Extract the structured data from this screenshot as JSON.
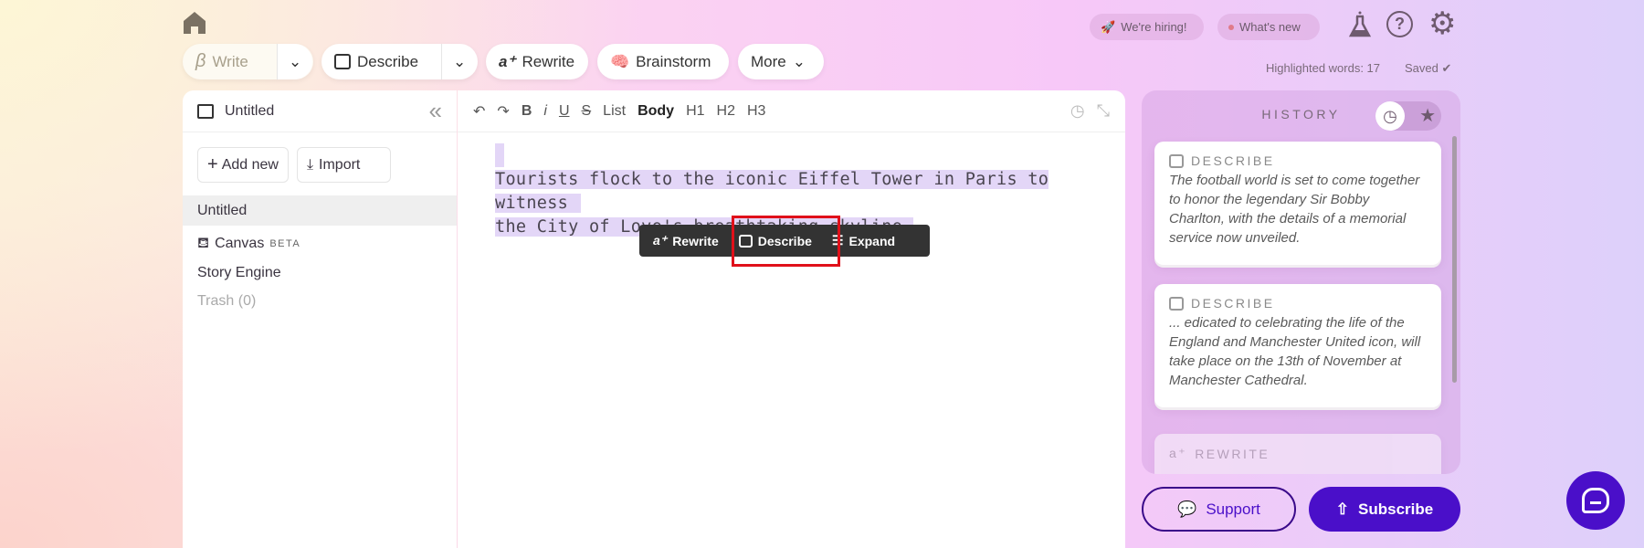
{
  "toolbar": {
    "write": "Write",
    "describe": "Describe",
    "rewrite": "Rewrite",
    "brainstorm": "Brainstorm",
    "more": "More"
  },
  "header": {
    "hiring": "We're hiring!",
    "whats_new": "What's new",
    "highlighted": "Highlighted words: 17",
    "saved": "Saved"
  },
  "sidebar": {
    "title": "Untitled",
    "add_new": "Add new",
    "import": "Import",
    "items": [
      {
        "label": "Untitled"
      },
      {
        "label": "Canvas",
        "badge": "BETA"
      },
      {
        "label": "Story Engine"
      },
      {
        "label": "Trash (0)"
      }
    ]
  },
  "editor": {
    "format": [
      "List",
      "Body",
      "H1",
      "H2",
      "H3"
    ],
    "bold": "B",
    "italic": "i",
    "underline": "U",
    "strike": "S",
    "lines": [
      "Tourists flock to the iconic Eiffel Tower in Paris to witness",
      "the City of Love's breathtaking skyline."
    ]
  },
  "floating": {
    "rewrite": "Rewrite",
    "describe": "Describe",
    "expand": "Expand"
  },
  "history": {
    "title": "HISTORY",
    "cards": [
      {
        "type": "DESCRIBE",
        "text": "The football world is set to come together to honor the legendary Sir Bobby Charlton, with the details of a memorial service now unveiled."
      },
      {
        "type": "DESCRIBE",
        "text": "... edicated to celebrating the life of the England and Manchester United icon, will take place on the 13th of November at Manchester Cathedral."
      },
      {
        "type": "REWRITE"
      }
    ]
  },
  "footer": {
    "support": "Support",
    "subscribe": "Subscribe"
  },
  "colors": {
    "accent": "#4a0fc9",
    "highlight": "#e3d6f7",
    "annotation_box": "#e0101a"
  }
}
